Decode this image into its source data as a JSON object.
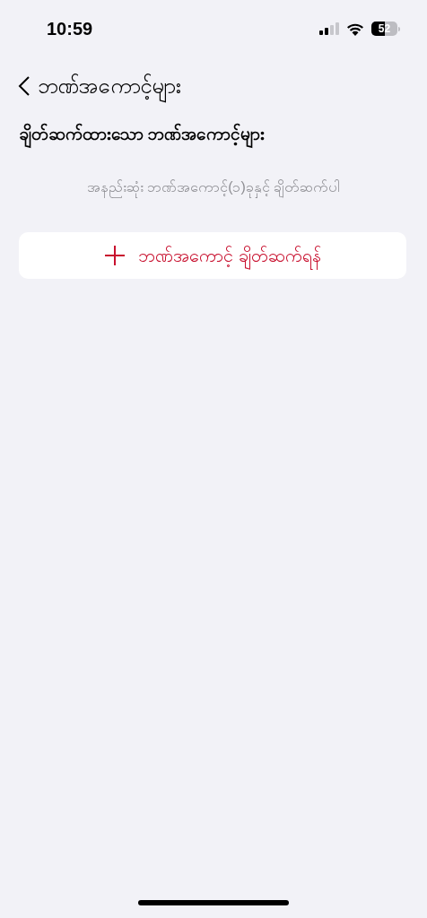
{
  "status_bar": {
    "time": "10:59",
    "battery": "52"
  },
  "nav": {
    "back_label": "ဘဏ်အကောင့်များ"
  },
  "section": {
    "title": "ချိတ်ဆက်ထားသော ဘဏ်အကောင့်များ",
    "empty_message": "အနည်းဆုံး ဘဏ်အကောင့်(၁)ခုနှင့် ချိတ်ဆက်ပါ"
  },
  "add_button": {
    "label": "ဘဏ်အကောင့် ချိတ်ဆက်ရန်"
  }
}
